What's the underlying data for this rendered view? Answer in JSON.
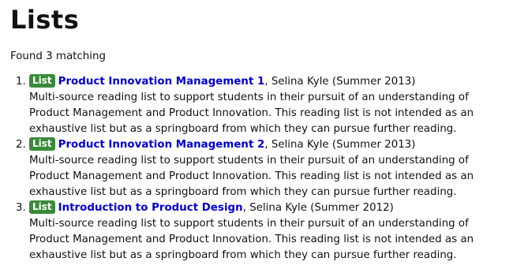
{
  "page": {
    "heading": "Lists",
    "found_text": "Found 3 matching"
  },
  "results": [
    {
      "badge": "List",
      "title": "Product Innovation Management 1",
      "meta": ", Selina Kyle (Summer 2013)",
      "description": "Multi-source reading list to support students in their pursuit of an understanding of Product Management and Product Innovation. This reading list is not intended as an exhaustive list but as a springboard from which they can pursue further reading."
    },
    {
      "badge": "List",
      "title": "Product Innovation Management 2",
      "meta": ", Selina Kyle (Summer 2013)",
      "description": "Multi-source reading list to support students in their pursuit of an understanding of Product Management and Product Innovation. This reading list is not intended as an exhaustive list but as a springboard from which they can pursue further reading."
    },
    {
      "badge": "List",
      "title": "Introduction to Product Design",
      "meta": ", Selina Kyle (Summer 2012)",
      "description": "Multi-source reading list to support students in their pursuit of an understanding of Product Management and Product Innovation. This reading list is not intended as an exhaustive list but as a springboard from which they can pursue further reading."
    }
  ],
  "colors": {
    "badge_background": "#3a8a3a",
    "link": "#0000cc",
    "text": "#111111"
  }
}
